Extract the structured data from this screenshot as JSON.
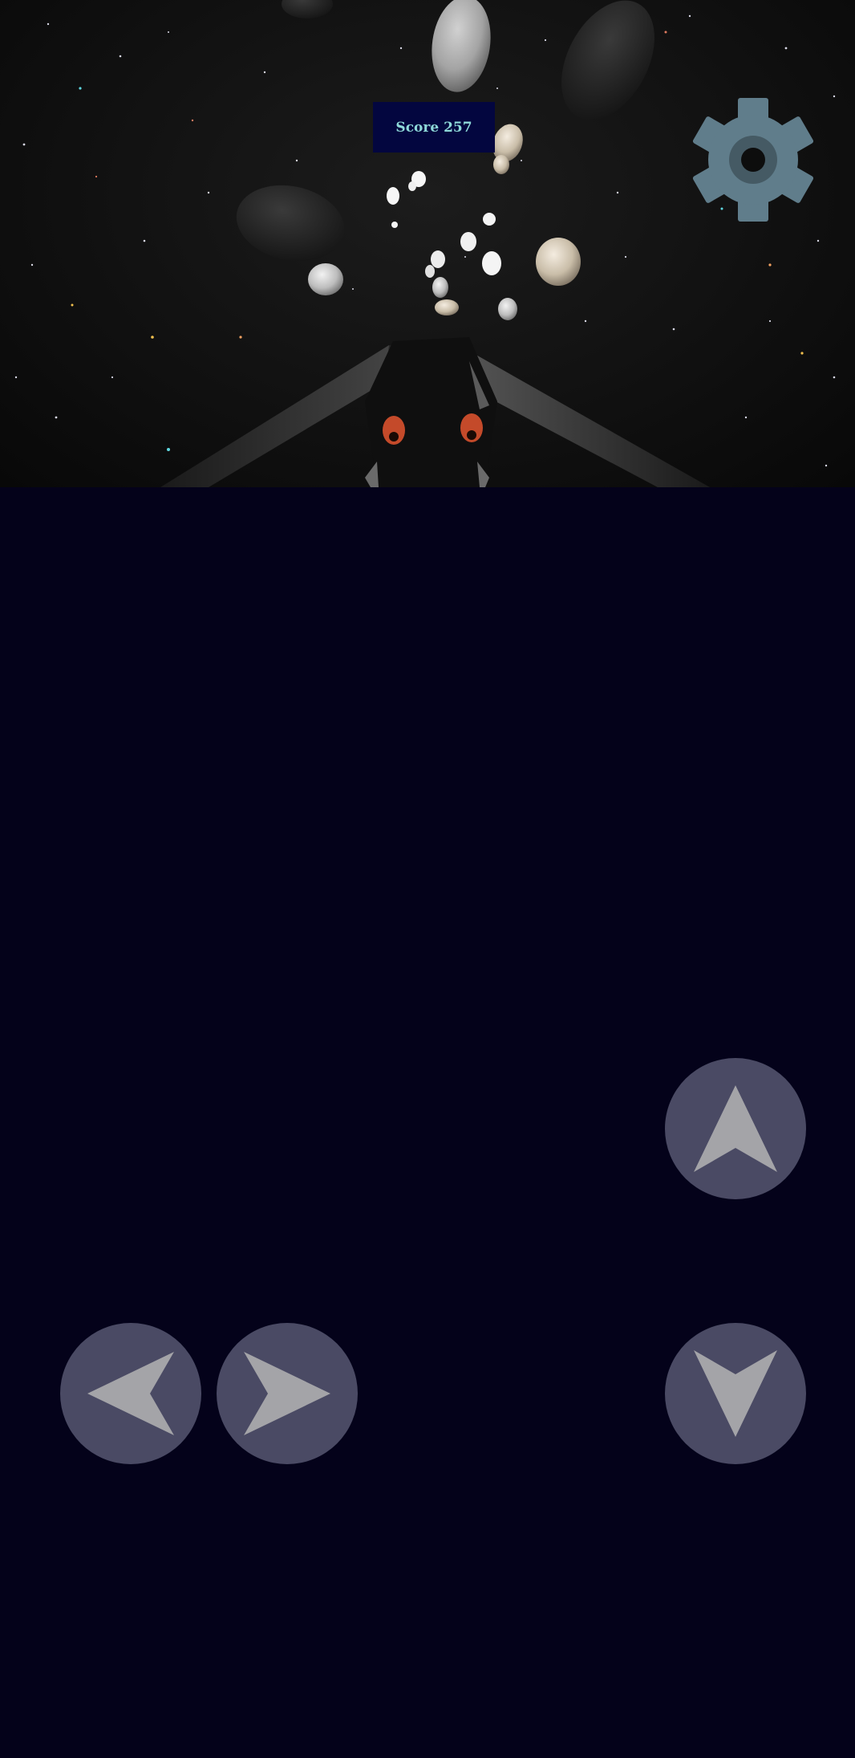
{
  "hud": {
    "score_text": "Score 257"
  },
  "controls": {
    "settings_icon": "gear-icon",
    "up_icon": "arrow-up-icon",
    "down_icon": "arrow-down-icon",
    "left_icon": "arrow-left-icon",
    "right_icon": "arrow-right-icon"
  },
  "colors": {
    "background": "#04021a",
    "score_box": "#03063f",
    "score_text": "#8ed9d9",
    "control_button": "#4a4a64",
    "control_arrow": "#a4a4a8",
    "gear": "#607d8b"
  }
}
